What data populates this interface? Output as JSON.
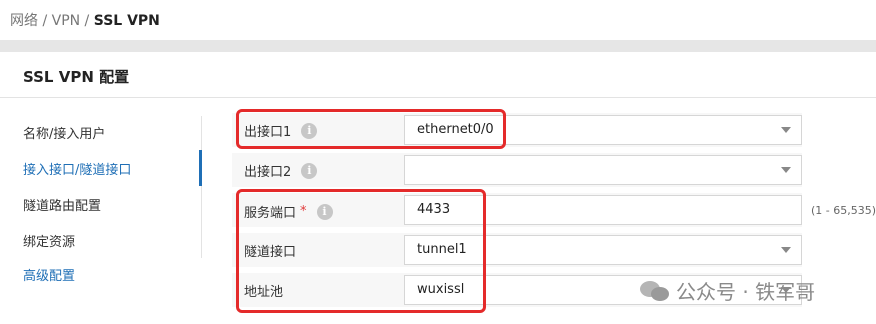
{
  "breadcrumb": {
    "part1": "网络 / VPN / ",
    "current": "SSL VPN"
  },
  "panel": {
    "title": "SSL VPN 配置"
  },
  "nav": {
    "items": [
      {
        "label": "名称/接入用户"
      },
      {
        "label": "接入接口/隧道接口"
      },
      {
        "label": "隧道路由配置"
      },
      {
        "label": "绑定资源"
      },
      {
        "label": "高级配置"
      }
    ],
    "active_index": 1
  },
  "form": {
    "out_if1": {
      "label": "出接口1",
      "value": "ethernet0/0"
    },
    "out_if2": {
      "label": "出接口2",
      "value": ""
    },
    "service_port": {
      "label": "服务端口",
      "required_mark": "*",
      "value": "4433",
      "range": "(1 - 65,535)"
    },
    "tunnel_if": {
      "label": "隧道接口",
      "value": "tunnel1"
    },
    "addr_pool": {
      "label": "地址池",
      "value": "wuxissl"
    }
  },
  "watermark": {
    "text": "公众号 · 铁军哥"
  },
  "colors": {
    "accent": "#1f6fb6",
    "highlight": "#e42a2a",
    "required": "#e03a3a"
  },
  "icons": [
    "info-icon",
    "chevron-down-icon",
    "wechat-icon"
  ]
}
